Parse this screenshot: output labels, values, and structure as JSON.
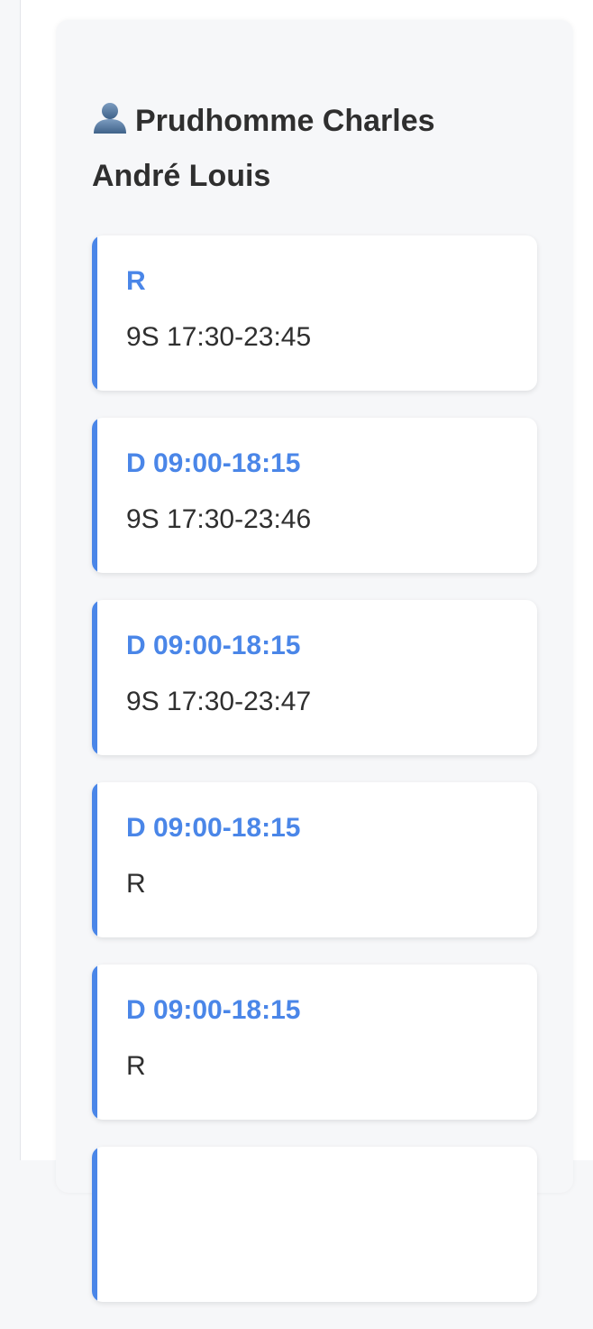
{
  "person": {
    "name": "Prudhomme Charles André Louis",
    "icon": "user-icon"
  },
  "colors": {
    "accent": "#4a86e8",
    "text": "#2f2f2f",
    "card_background": "#f6f7f9"
  },
  "shifts": [
    {
      "title": "R",
      "detail": "9S 17:30-23:45"
    },
    {
      "title": "D 09:00-18:15",
      "detail": "9S 17:30-23:46"
    },
    {
      "title": "D 09:00-18:15",
      "detail": "9S 17:30-23:47"
    },
    {
      "title": "D 09:00-18:15",
      "detail": "R"
    },
    {
      "title": "D 09:00-18:15",
      "detail": "R"
    },
    {
      "title": "",
      "detail": ""
    }
  ]
}
